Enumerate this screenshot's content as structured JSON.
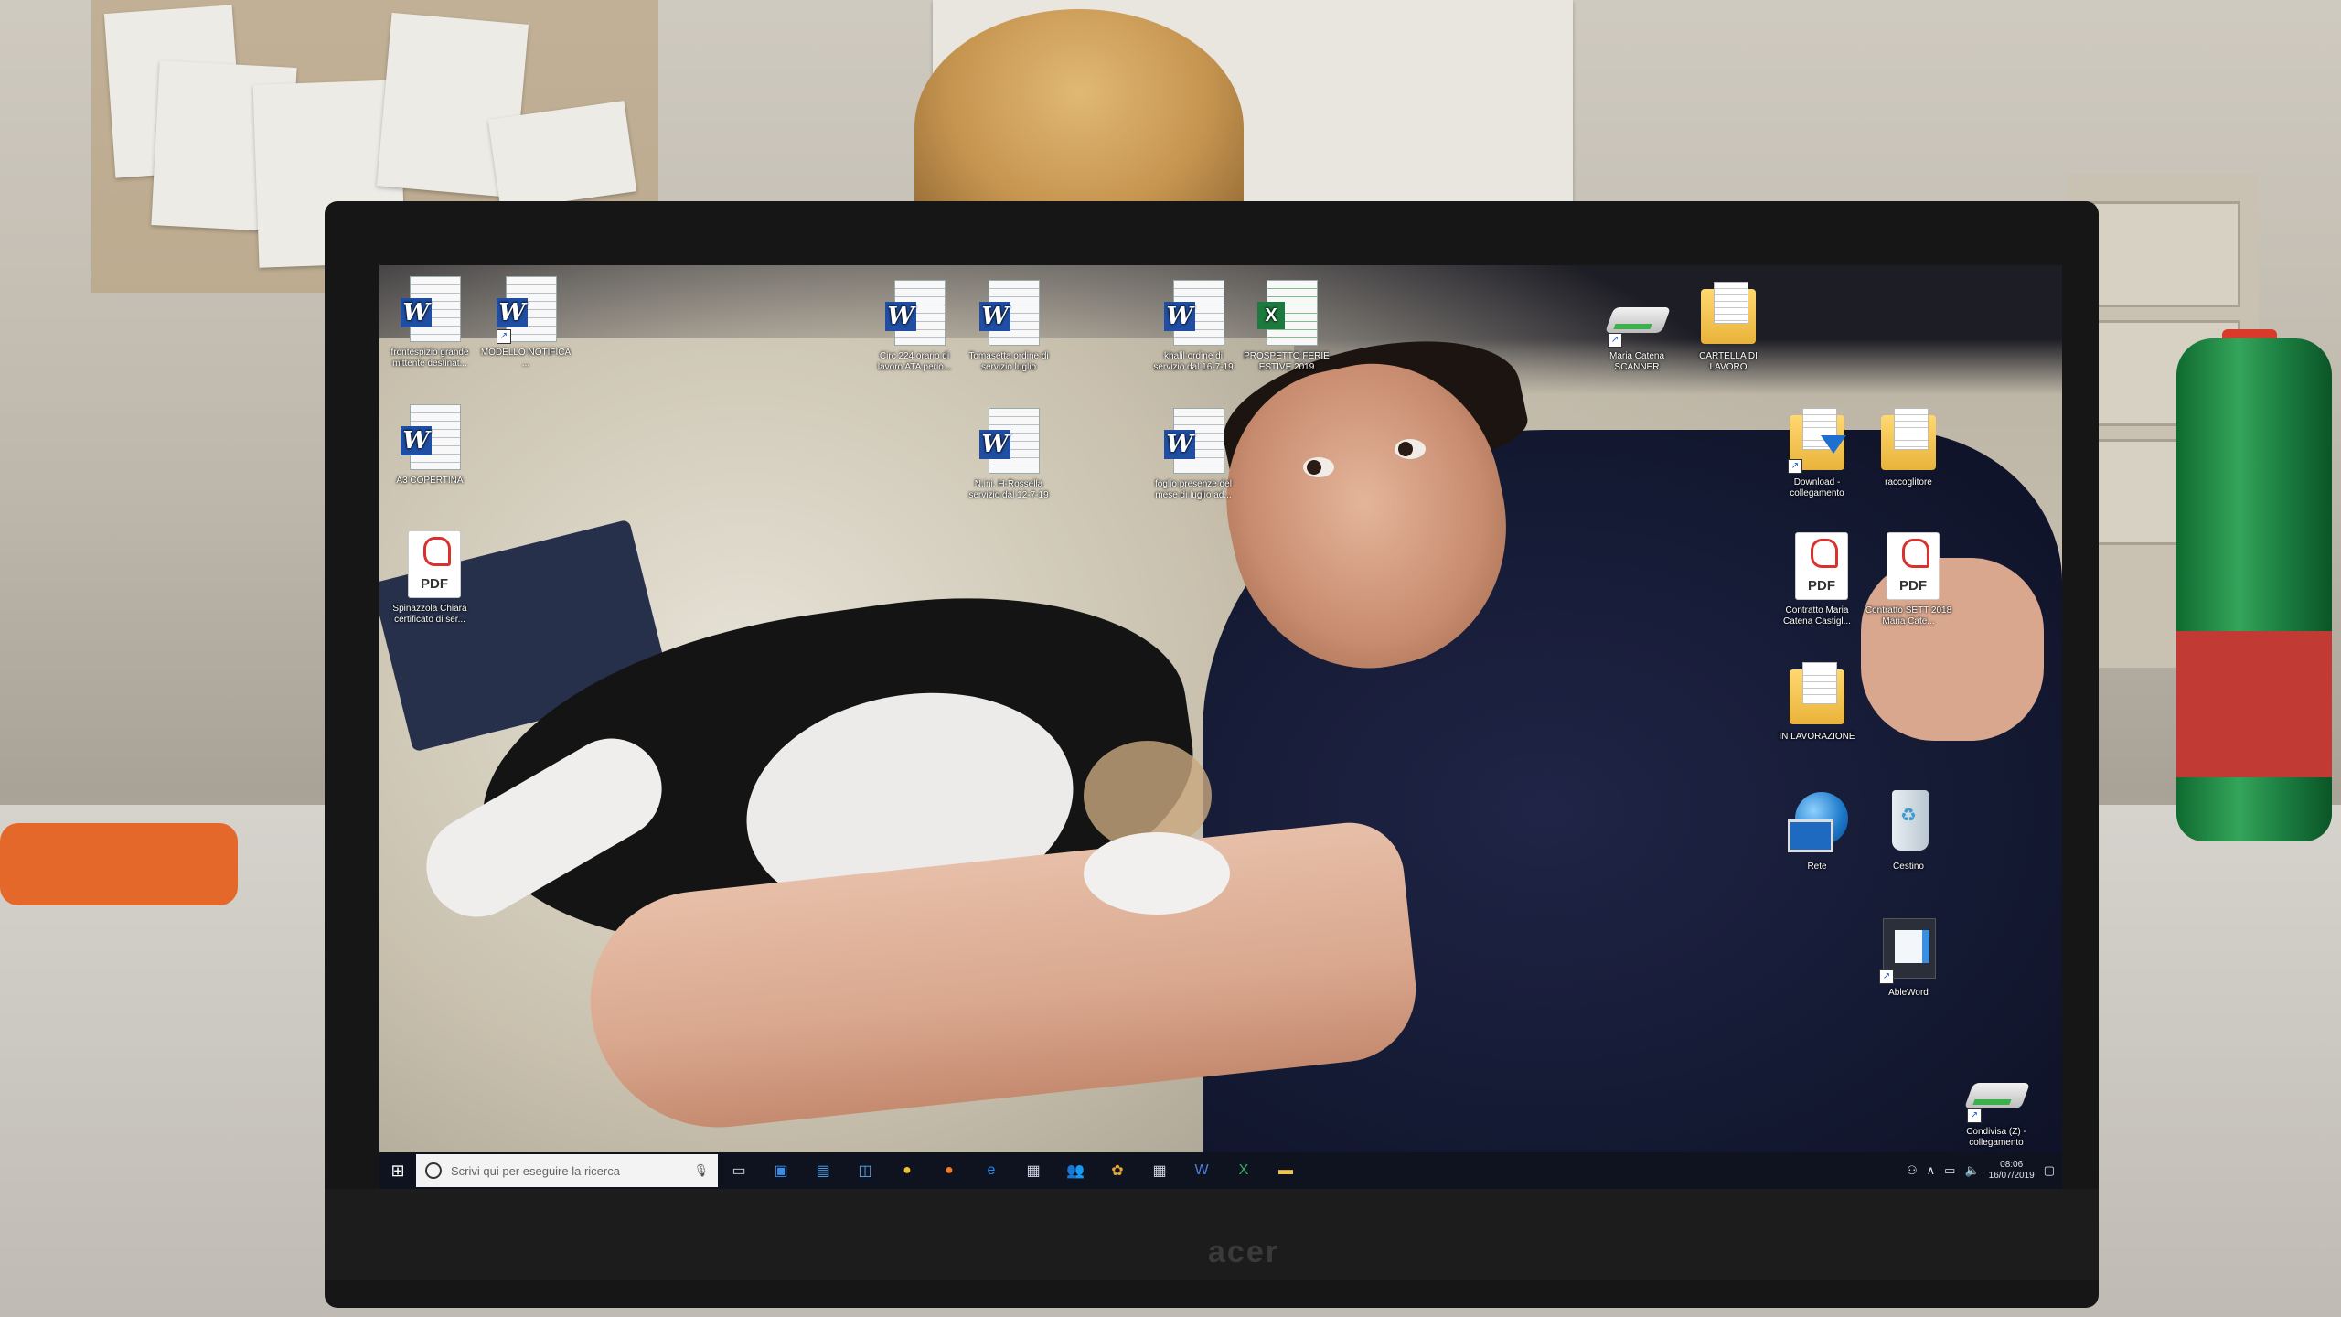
{
  "desktop": {
    "icons": [
      {
        "label": "frontespizio grande mittente destinat..."
      },
      {
        "label": "MODELLO NOTIFICA ..."
      },
      {
        "label": "Circ 224 orario di lavoro ATA perio..."
      },
      {
        "label": "Tomasetta ordine di servizio luglio"
      },
      {
        "label": "khalil ordine di servizio dal 16-7-19"
      },
      {
        "label": "PROSPETTO FERIE ESTIVE 2019"
      },
      {
        "label": "Maria Catena SCANNER"
      },
      {
        "label": "CARTELLA DI LAVORO"
      },
      {
        "label": "A3 COPERTINA"
      },
      {
        "label": "N.ini. H-Rossella servizio dal 12-7-19"
      },
      {
        "label": "foglio presenze del mese di luglio ad..."
      },
      {
        "label": "Download - collegamento"
      },
      {
        "label": "raccoglitore"
      },
      {
        "label": "Spinazzola Chiara certificato di ser..."
      },
      {
        "label": "Contratto Maria Catena Castigl..."
      },
      {
        "label": "Contratto SETT 2018 Maria Cate..."
      },
      {
        "label": "IN LAVORAZIONE"
      },
      {
        "label": "Rete"
      },
      {
        "label": "Cestino"
      },
      {
        "label": "AbleWord"
      },
      {
        "label": "Condivisa (Z) - collegamento"
      }
    ],
    "badges": {
      "word": "W",
      "excel": "X",
      "pdf": "PDF",
      "shortcut": "↗"
    }
  },
  "taskbar": {
    "start_icon": "windows-logo",
    "search_placeholder": "Scrivi qui per eseguire la ricerca",
    "pinned": [
      "task-view",
      "outlook",
      "store",
      "explorer-alt",
      "chrome",
      "firefox",
      "edge",
      "calendar",
      "people",
      "photos",
      "calculator",
      "word",
      "excel",
      "file-explorer"
    ],
    "clock_time": "08:06",
    "clock_date": "16/07/2019"
  },
  "monitor": {
    "brand": "acer"
  },
  "colors": {
    "taskbar": "#0f1320",
    "word": "#1f4ea3",
    "excel": "#1c7a3f",
    "pdf": "#d8322f",
    "folder": "#e9b33a"
  }
}
